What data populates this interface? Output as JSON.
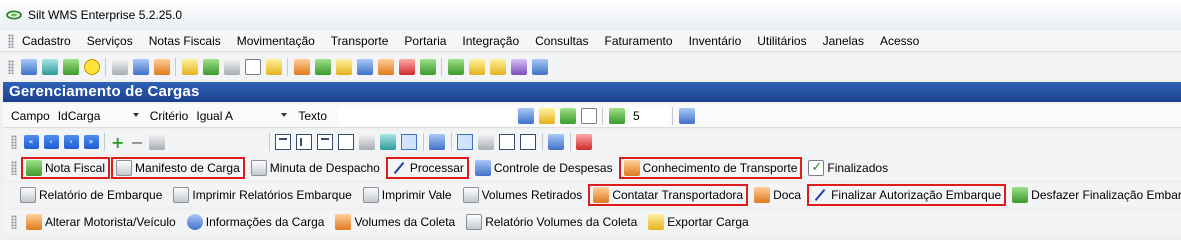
{
  "window": {
    "title": "Silt WMS Enterprise 5.2.25.0",
    "app_icon": "silt-logo-icon"
  },
  "menubar": {
    "items": [
      "Cadastro",
      "Serviços",
      "Notas Fiscais",
      "Movimentação",
      "Transporte",
      "Portaria",
      "Integração",
      "Consultas",
      "Faturamento",
      "Inventário",
      "Utilitários",
      "Janelas",
      "Acesso"
    ]
  },
  "panel": {
    "title": "Gerenciamento de Cargas"
  },
  "filter": {
    "campo_label": "Campo",
    "campo_value": "IdCarga",
    "criterio_label": "Critério",
    "criterio_value": "Igual A",
    "texto_label": "Texto",
    "texto_value": "",
    "count_value": "5"
  },
  "buttons_row1": [
    {
      "label": "Nota Fiscal",
      "icon": "document-refresh-icon",
      "highlight": true
    },
    {
      "label": "Manifesto de Carga",
      "icon": "printer-icon",
      "highlight": true
    },
    {
      "label": "Minuta de Despacho",
      "icon": "printer-icon",
      "highlight": false
    },
    {
      "label": "Processar",
      "icon": "pen-icon",
      "highlight": true
    },
    {
      "label": "Controle de Despesas",
      "icon": "spreadsheet-icon",
      "highlight": false
    },
    {
      "label": "Conhecimento de Transporte",
      "icon": "documents-icon",
      "highlight": true
    },
    {
      "label": "Finalizados",
      "icon": "checklist-icon",
      "highlight": false
    }
  ],
  "buttons_row2": [
    {
      "label": "Relatório de Embarque",
      "icon": "printer-icon",
      "highlight": false
    },
    {
      "label": "Imprimir Relatórios Embarque",
      "icon": "printer-icon",
      "highlight": false
    },
    {
      "label": "Imprimir Vale",
      "icon": "printer-icon",
      "highlight": false
    },
    {
      "label": "Volumes Retirados",
      "icon": "printer-icon",
      "highlight": false
    },
    {
      "label": "Contatar Transportadora",
      "icon": "user-contact-icon",
      "highlight": true
    },
    {
      "label": "Doca",
      "icon": "dock-icon",
      "highlight": false
    },
    {
      "label": "Finalizar Autorização Embarque",
      "icon": "pen-icon",
      "highlight": true
    },
    {
      "label": "Desfazer Finalização Embarque",
      "icon": "document-refresh-icon",
      "highlight": false
    }
  ],
  "buttons_row3": [
    {
      "label": "Alterar Motorista/Veículo",
      "icon": "user-edit-icon"
    },
    {
      "label": "Informações da Carga",
      "icon": "info-icon"
    },
    {
      "label": "Volumes da Coleta",
      "icon": "boxes-icon"
    },
    {
      "label": "Relatório Volumes da Coleta",
      "icon": "printer-icon"
    },
    {
      "label": "Exportar Carga",
      "icon": "export-icon"
    }
  ],
  "colors": {
    "highlight_border": "#e01b1b",
    "panel_header": "#1f4aa0"
  }
}
